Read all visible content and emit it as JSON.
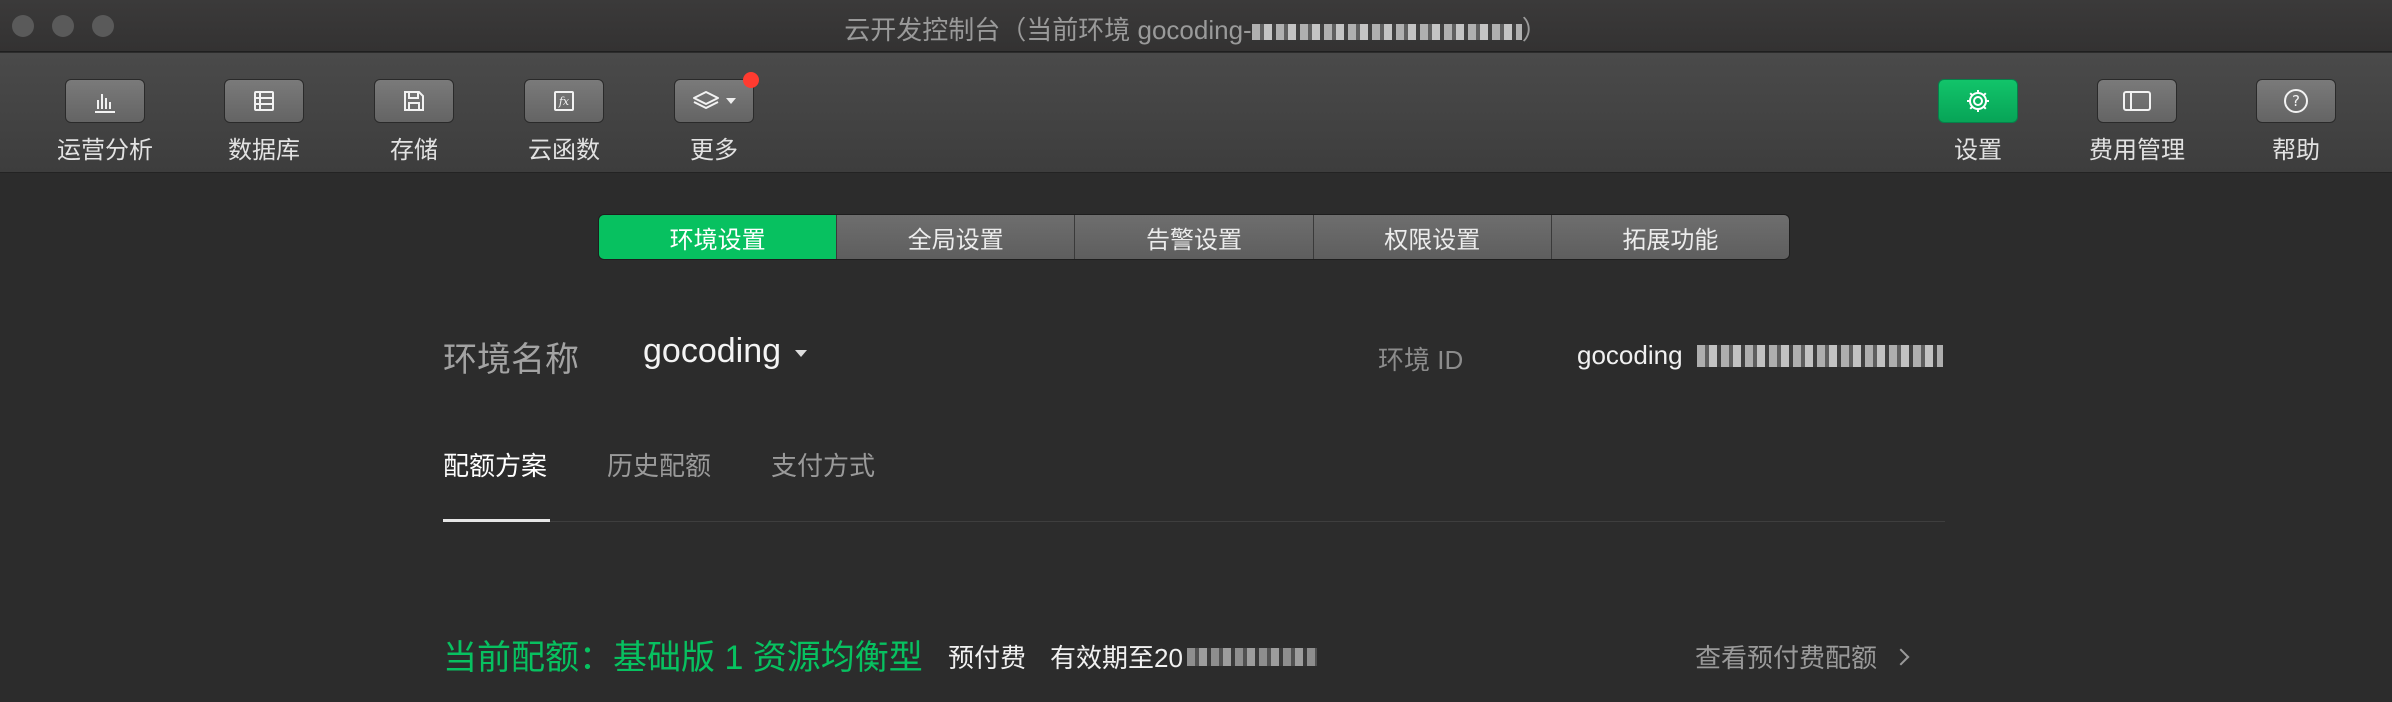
{
  "window": {
    "title": "云开发控制台（当前环境 gocoding-",
    "title_end": "）"
  },
  "toolbar": {
    "left": [
      {
        "label": "运营分析",
        "icon": "bar-chart-icon"
      },
      {
        "label": "数据库",
        "icon": "database-icon"
      },
      {
        "label": "存储",
        "icon": "floppy-disk-icon"
      },
      {
        "label": "云函数",
        "icon": "function-icon"
      },
      {
        "label": "更多",
        "icon": "layers-icon"
      }
    ],
    "right": [
      {
        "label": "设置",
        "icon": "gear-icon"
      },
      {
        "label": "费用管理",
        "icon": "billing-icon"
      },
      {
        "label": "帮助",
        "icon": "help-icon"
      }
    ]
  },
  "segments": [
    "环境设置",
    "全局设置",
    "告警设置",
    "权限设置",
    "拓展功能"
  ],
  "env": {
    "label": "环境名称",
    "name": "gocoding",
    "id_label": "环境 ID",
    "id_value": "gocoding"
  },
  "subtabs": [
    "配额方案",
    "历史配额",
    "支付方式"
  ],
  "quota": {
    "current": "当前配额：基础版 1 资源均衡型",
    "prepaid": "预付费",
    "validity": "有效期至20",
    "view_link": "查看预付费配额"
  },
  "colors": {
    "accent": "#07c160",
    "notification_dot": "#ff3b30"
  }
}
